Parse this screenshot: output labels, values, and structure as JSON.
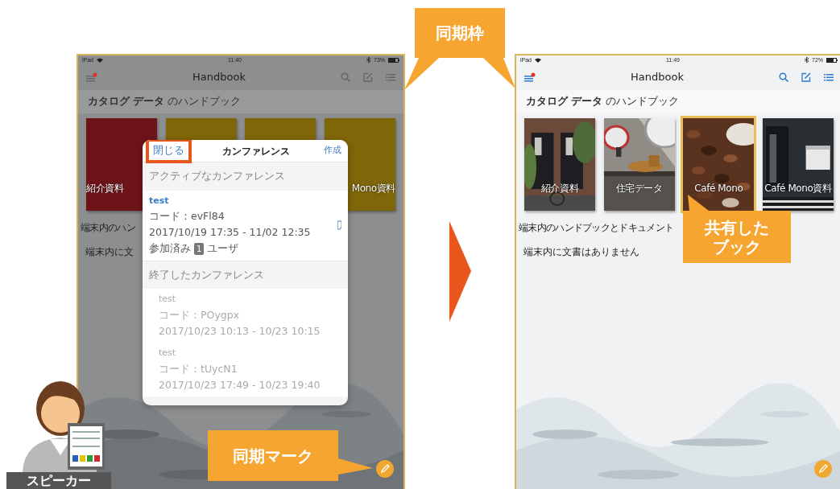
{
  "callouts": {
    "sync_frame": "同期枠",
    "shared_book": "共有したブック",
    "sync_mark": "同期マーク"
  },
  "speaker_label": "スピーカー",
  "screens": [
    {
      "dimmed": true,
      "status": {
        "device": "iPad",
        "time": "11:40",
        "battery": "73%"
      },
      "title": "Handbook",
      "heading": "**カタログ データ** のハンドブック",
      "books": [
        {
          "kind": "color",
          "color": "#6e1418",
          "label": "紹介資料"
        },
        {
          "kind": "color",
          "color": "#7f6608"
        },
        {
          "kind": "color",
          "color": "#7f6608"
        },
        {
          "kind": "color",
          "color": "#7f6608",
          "label": "Mono資料"
        }
      ],
      "local_heading": "端末内のハン",
      "local_empty": "端末内に文",
      "modal": {
        "close": {
          "label": "閉じる",
          "highlighted": true
        },
        "title": "カンファレンス",
        "create": "作成",
        "sections": [
          {
            "kind": "active",
            "heading": "アクティブなカンファレンス",
            "items": [
              {
                "name": "test",
                "code": "コード：evFl84",
                "period": "2017/10/19 17:35 - 11/02 12:35",
                "joined": "参加済み",
                "count": "1",
                "unit": "ユーザ"
              }
            ]
          },
          {
            "kind": "ended",
            "heading": "終了したカンファレンス",
            "items": [
              {
                "name": "test",
                "code": "コード：POygpx",
                "period": "2017/10/23 10:13 - 10/23 10:15"
              },
              {
                "name": "test",
                "code": "コード：tUycN1",
                "period": "2017/10/23 17:49 - 10/23 19:40"
              }
            ]
          }
        ]
      }
    },
    {
      "dimmed": false,
      "status": {
        "device": "iPad",
        "time": "11:49",
        "battery": "72%"
      },
      "title": "Handbook",
      "heading": "**カタログ データ** のハンドブック",
      "books": [
        {
          "kind": "picture",
          "label": "紹介資料",
          "selected": false
        },
        {
          "kind": "picture",
          "label": "住宅データ",
          "selected": false
        },
        {
          "kind": "picture",
          "label": "Café Mono",
          "selected": true
        },
        {
          "kind": "picture",
          "label": "Café Mono資料",
          "selected": false
        }
      ],
      "local_heading": "端末内のハンドブックとドキュメント",
      "local_empty": "端末内に文書はありません"
    }
  ]
}
